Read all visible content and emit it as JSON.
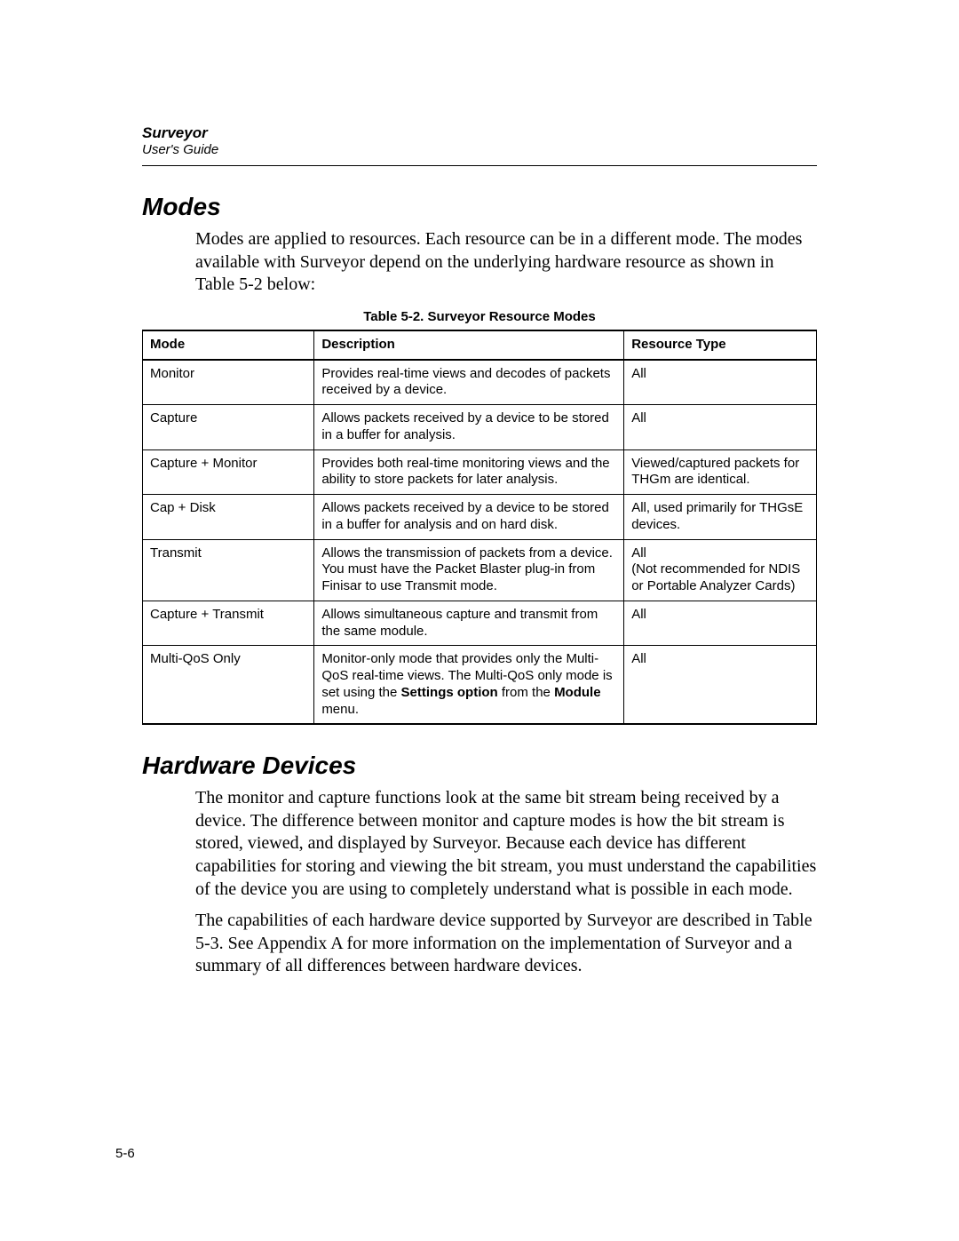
{
  "header": {
    "title": "Surveyor",
    "subtitle": "User's Guide"
  },
  "section1": {
    "heading": "Modes",
    "para": "Modes are applied to resources. Each resource can be in a different mode. The modes available with Surveyor depend on the underlying hardware resource as shown in Table 5-2 below:"
  },
  "table": {
    "caption": "Table 5-2. Surveyor Resource Modes",
    "headers": {
      "c1": "Mode",
      "c2": "Description",
      "c3": "Resource Type"
    },
    "rows": [
      {
        "mode": "Monitor",
        "desc": "Provides real-time views and decodes of packets received by a device.",
        "res": "All"
      },
      {
        "mode": "Capture",
        "desc": "Allows packets received by a device to be stored in a buffer for analysis.",
        "res": "All"
      },
      {
        "mode": "Capture + Monitor",
        "desc": "Provides both real-time monitoring views and the ability to store packets for later analysis.",
        "res": "Viewed/captured packets for THGm are identical."
      },
      {
        "mode": "Cap + Disk",
        "desc": "Allows packets received by a device to be stored in a buffer for analysis and on hard disk.",
        "res": "All, used primarily for THGsE devices."
      },
      {
        "mode": "Transmit",
        "desc": "Allows the transmission of packets from a device. You must have the Packet Blaster plug-in from Finisar to use Transmit mode.",
        "res": "All\n(Not recommended for NDIS or Portable Analyzer Cards)"
      },
      {
        "mode": "Capture + Transmit",
        "desc": "Allows simultaneous capture and transmit from the same module.",
        "res": "All"
      },
      {
        "mode": "Multi-QoS Only",
        "desc_pre": "Monitor-only mode that provides only the Multi-QoS real-time views. The Multi-QoS only mode is set using the ",
        "desc_bold1": "Settings option",
        "desc_mid": " from the ",
        "desc_bold2": "Module",
        "desc_post": " menu.",
        "res": "All"
      }
    ]
  },
  "section2": {
    "heading": "Hardware Devices",
    "para1": "The monitor and capture functions look at the same bit stream being received by a device. The difference between monitor and capture modes is how the bit stream is stored, viewed, and displayed by Surveyor. Because each device has different capabilities for storing and viewing the bit stream, you must understand the capabilities of the device you are using to completely understand what is possible in each mode.",
    "para2": "The capabilities of each hardware device supported by Surveyor are described in Table 5-3. See Appendix A for more information on the implementation of Surveyor and a summary of all differences between hardware devices."
  },
  "footer": {
    "page": "5-6"
  }
}
